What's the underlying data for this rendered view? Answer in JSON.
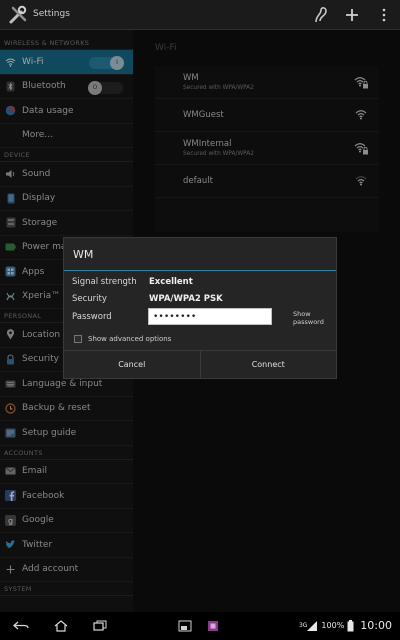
{
  "app": {
    "title": "Settings"
  },
  "sidebar": {
    "sections": [
      "WIRELESS & NETWORKS",
      "DEVICE",
      "PERSONAL",
      "ACCOUNTS",
      "SYSTEM"
    ],
    "items": [
      {
        "label": "Wi-Fi",
        "icon": "wifi-icon",
        "toggle_label": "I"
      },
      {
        "label": "Bluetooth",
        "icon": "bluetooth-icon",
        "toggle_label": "O"
      },
      {
        "label": "Data usage",
        "icon": "data-usage-icon"
      },
      {
        "label": "More…",
        "icon": ""
      },
      {
        "label": "Sound",
        "icon": "speaker-icon"
      },
      {
        "label": "Display",
        "icon": "display-icon"
      },
      {
        "label": "Storage",
        "icon": "storage-icon"
      },
      {
        "label": "Power man",
        "icon": "battery-icon"
      },
      {
        "label": "Apps",
        "icon": "apps-icon"
      },
      {
        "label": "Xperia™",
        "icon": "xperia-icon"
      },
      {
        "label": "Location so",
        "icon": "location-icon"
      },
      {
        "label": "Security",
        "icon": "lock-icon"
      },
      {
        "label": "Language & input",
        "icon": "keyboard-icon"
      },
      {
        "label": "Backup & reset",
        "icon": "backup-icon"
      },
      {
        "label": "Setup guide",
        "icon": "setup-guide-icon"
      },
      {
        "label": "Email",
        "icon": "email-icon"
      },
      {
        "label": "Facebook",
        "icon": "facebook-icon"
      },
      {
        "label": "Google",
        "icon": "google-icon"
      },
      {
        "label": "Twitter",
        "icon": "twitter-icon"
      },
      {
        "label": "Add account",
        "icon": "plus-icon"
      }
    ]
  },
  "wifi": {
    "header": "Wi-Fi",
    "networks": [
      {
        "name": "WM",
        "security": "Secured with WPA/WPA2",
        "locked": true
      },
      {
        "name": "WMGuest",
        "security": "",
        "locked": false
      },
      {
        "name": "WMInternal",
        "security": "Secured with WPA/WPA2",
        "locked": true
      },
      {
        "name": "default",
        "security": "",
        "locked": false
      }
    ]
  },
  "dialog": {
    "title": "WM",
    "signal_label": "Signal strength",
    "signal_value": "Excellent",
    "security_label": "Security",
    "security_value": "WPA/WPA2 PSK",
    "password_label": "Password",
    "password_value": "••••••••",
    "show_password_label": "Show password",
    "advanced_label": "Show advanced options",
    "cancel_label": "Cancel",
    "connect_label": "Connect"
  },
  "status": {
    "battery": "100%",
    "time": "10:00",
    "network": "3G"
  },
  "colors": {
    "accent": "#1a6f91",
    "divider": "#2b7fa3",
    "background": "#101010"
  }
}
